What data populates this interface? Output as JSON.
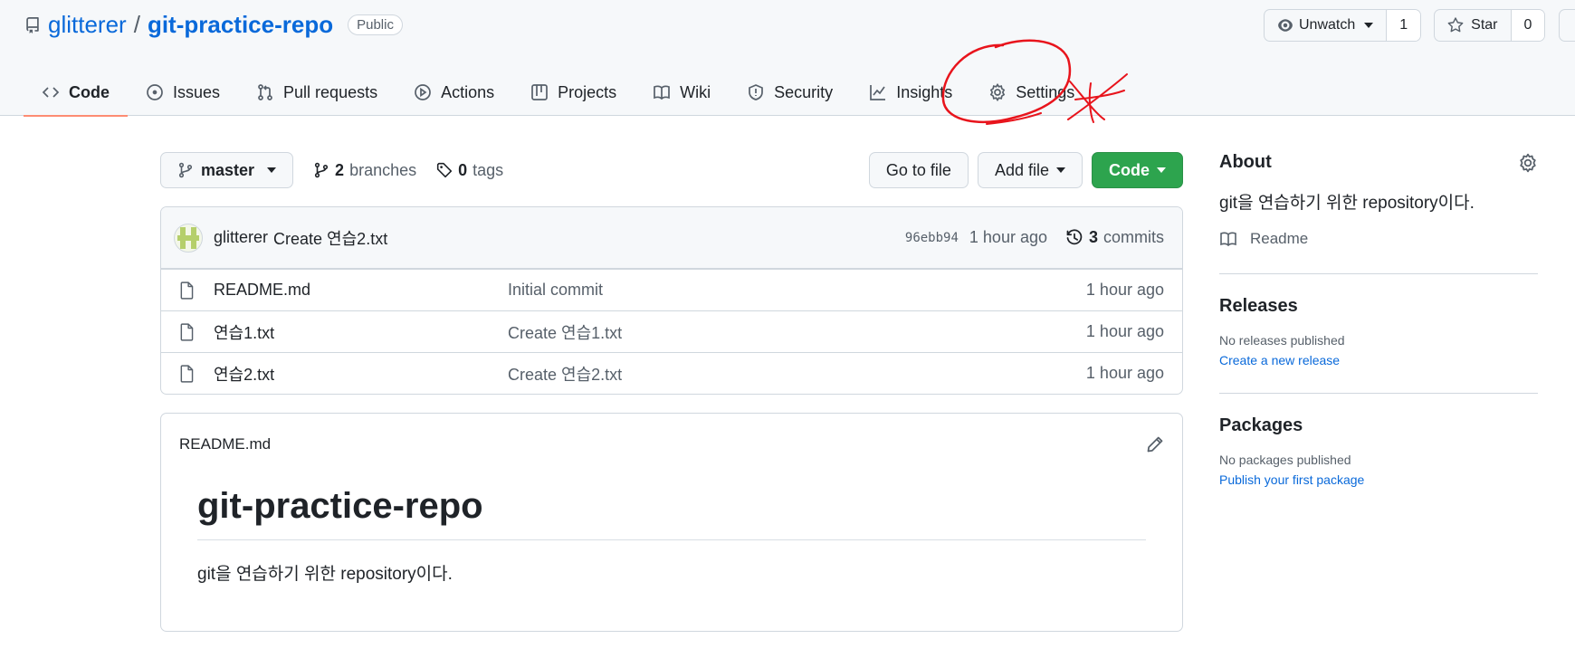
{
  "repo": {
    "owner": "glitterer",
    "separator": "/",
    "name": "git-practice-repo",
    "visibility": "Public"
  },
  "header_actions": {
    "watch_label": "Unwatch",
    "watch_count": "1",
    "star_label": "Star",
    "star_count": "0"
  },
  "tabs": [
    {
      "label": "Code",
      "icon": "code-icon",
      "active": true
    },
    {
      "label": "Issues",
      "icon": "issue-icon"
    },
    {
      "label": "Pull requests",
      "icon": "pull-request-icon"
    },
    {
      "label": "Actions",
      "icon": "play-icon"
    },
    {
      "label": "Projects",
      "icon": "table-icon"
    },
    {
      "label": "Wiki",
      "icon": "book-icon"
    },
    {
      "label": "Security",
      "icon": "shield-icon"
    },
    {
      "label": "Insights",
      "icon": "graph-icon"
    },
    {
      "label": "Settings",
      "icon": "gear-icon"
    }
  ],
  "toolbar": {
    "branch": "master",
    "branches_count": "2",
    "branches_label": "branches",
    "tags_count": "0",
    "tags_label": "tags",
    "go_to_file": "Go to file",
    "add_file": "Add file",
    "code": "Code"
  },
  "latest_commit": {
    "author": "glitterer",
    "message": "Create 연습2.txt",
    "sha": "96ebb94",
    "age": "1 hour ago",
    "commits_count": "3",
    "commits_label": "commits"
  },
  "files": [
    {
      "name": "README.md",
      "message": "Initial commit",
      "age": "1 hour ago"
    },
    {
      "name": "연습1.txt",
      "message": "Create 연습1.txt",
      "age": "1 hour ago"
    },
    {
      "name": "연습2.txt",
      "message": "Create 연습2.txt",
      "age": "1 hour ago"
    }
  ],
  "readme": {
    "filename": "README.md",
    "heading": "git-practice-repo",
    "body": "git을 연습하기 위한 repository이다."
  },
  "sidebar": {
    "about_title": "About",
    "about_desc": "git을 연습하기 위한 repository이다.",
    "readme_link": "Readme",
    "releases_title": "Releases",
    "releases_none": "No releases published",
    "releases_link": "Create a new release",
    "packages_title": "Packages",
    "packages_none": "No packages published",
    "packages_link": "Publish your first package"
  },
  "colors": {
    "link_blue": "#0969da",
    "green_button": "#2da44e",
    "active_tab_underline": "#fd8c73",
    "annotation_red": "#e8141c"
  }
}
